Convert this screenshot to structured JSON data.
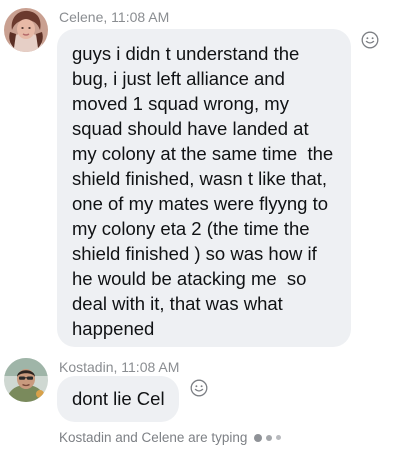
{
  "messages": [
    {
      "sender": "Celene",
      "time": "11:08 AM",
      "lines": [
        "guys i didn t understand the",
        "bug, i just left alliance and",
        "moved 1 squad wrong, my",
        "squad should have landed at",
        "my colony at the same time  the",
        "shield finished, wasn t like that,",
        "one of my mates were flyyng to",
        "my colony eta 2 (the time the",
        "shield finished ) so was how if",
        "he would be atacking me  so",
        "deal with it, that was what",
        "happened"
      ],
      "avatar": "avatar-photo",
      "reaction_icon": "smiley-face-icon"
    },
    {
      "sender": "Kostadin",
      "time": "11:08 AM",
      "lines": [
        "dont lie Cel"
      ],
      "avatar": "avatar-photo",
      "reaction_icon": "smiley-face-icon"
    }
  ],
  "typing": {
    "text": "Kostadin and Celene are typing",
    "icon": "typing-dots-icon"
  },
  "colors": {
    "bubble": "#eef0f3",
    "meta_text": "#8a8d91",
    "message_text": "#101214"
  }
}
